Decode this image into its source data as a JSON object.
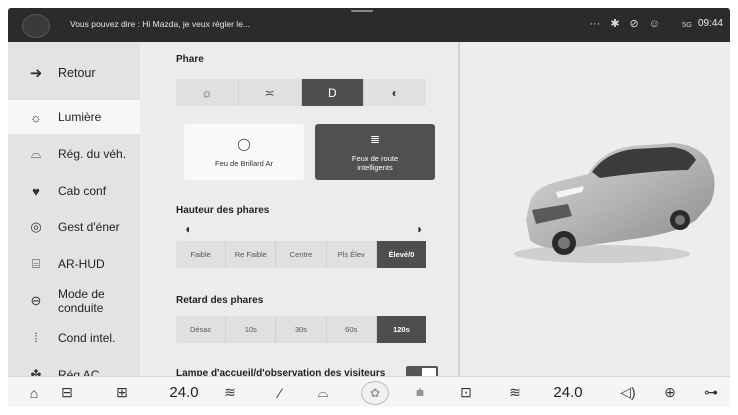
{
  "status_bar": {
    "voice_hint": "Vous pouvez dire : Hi Mazda, je veux régler le...",
    "icons": [
      "more-icon",
      "bluetooth-icon",
      "no-signal-icon",
      "user-icon"
    ],
    "signal_text": "5G",
    "time": "09:44"
  },
  "sidebar": {
    "back_label": "Retour",
    "items": [
      {
        "label": "Lumière",
        "icon": "sun-icon",
        "active": true
      },
      {
        "label": "Rég. du véh.",
        "icon": "car-icon",
        "active": false
      },
      {
        "label": "Cab conf",
        "icon": "seat-icon",
        "active": false
      },
      {
        "label": "Gest d'éner",
        "icon": "energy-icon",
        "active": false
      },
      {
        "label": "AR-HUD",
        "icon": "hud-icon",
        "active": false
      },
      {
        "label": "Mode de conduite",
        "icon": "steering-icon",
        "active": false
      },
      {
        "label": "Cond intel.",
        "icon": "intel-drive-icon",
        "active": false
      },
      {
        "label": "Rég AC",
        "icon": "fan-icon",
        "active": false
      }
    ]
  },
  "phare": {
    "title": "Phare",
    "modes": [
      {
        "icon": "off-light-icon",
        "glyph": "☼",
        "selected": false
      },
      {
        "icon": "parking-light-icon",
        "glyph": "≍",
        "selected": false
      },
      {
        "icon": "low-beam-icon",
        "glyph": "D",
        "selected": true
      },
      {
        "icon": "auto-beam-icon",
        "glyph": "◐",
        "selected": false
      }
    ],
    "cards": [
      {
        "label": "Feu de Brillard Ar",
        "glyph": "◯",
        "selected": false
      },
      {
        "label": "Feux de route intelligents",
        "glyph": "≣",
        "selected": true
      }
    ]
  },
  "hauteur": {
    "title": "Hauteur des phares",
    "options": [
      "Faible",
      "Re Faible",
      "Centre",
      "Pls Élev",
      "Élevé/0"
    ],
    "selected_index": 4
  },
  "retard": {
    "title": "Retard des phares",
    "options": [
      "Désac",
      "10s",
      "30s",
      "60s",
      "120s"
    ],
    "selected_index": 4
  },
  "lampe": {
    "title": "Lampe d'accueil/d'observation des visiteurs",
    "enabled": true
  },
  "bottom_bar": {
    "temp_left": "24.0",
    "temp_right": "24.0",
    "icons": [
      "home-icon",
      "car-icon",
      "apps-icon",
      "seat-heat-icon",
      "wiper-icon",
      "car-outline-icon",
      "fan-icon",
      "defrost-front-icon",
      "defrost-rear-icon",
      "seat-heat-right-icon",
      "volume-icon",
      "lock-icon",
      "car-settings-icon"
    ]
  }
}
